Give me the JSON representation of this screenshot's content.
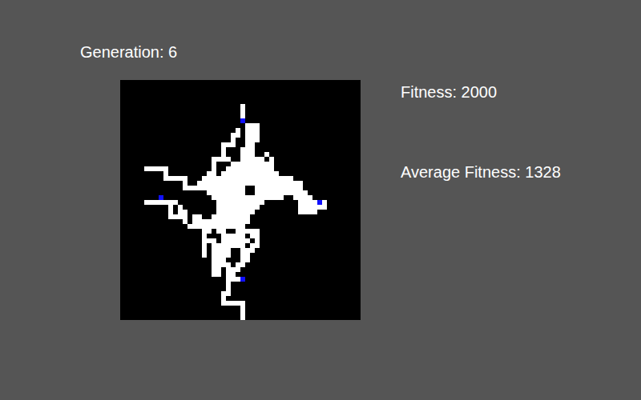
{
  "generation": {
    "label": "Generation: 6"
  },
  "stats": [
    {
      "label": "Fitness: 2000"
    },
    {
      "label": "Average Fitness: 1328"
    }
  ],
  "board": {
    "legend": {
      "empty": ".",
      "filled": "#",
      "agent": "o"
    },
    "rows": [
      "..................................................",
      "..................................................",
      "..................................................",
      "..................................................",
      "..................................................",
      ".........................#........................",
      ".........................#........................",
      ".........................#........................",
      ".........................o........................",
      "..........................###.....................",
      "........................#.###.....................",
      ".......................##.###.....................",
      ".......................#..###.....................",
      ".....................###..##......................",
      ".....................#...###......................",
      ".....................#...###..#...................",
      "...................####..#####.#..................",
      "...................#...#########..................",
      ".....#####.........#..##########..................",
      ".........#........##.############.................",
      ".........#####...###################..............",
      ".............#..######################............",
      ".............#############..##########............",
      "..................########..###########...........",
      "........o..........###############..####..........",
      ".....#######........##########.......####o#.......",
      "..........#.#.......#########........######.......",
      "..........#.##......########.........####.........",
      "..........####.##..########.......................",
      ".............#.############.......................",
      "..............############........................",
      ".................##.##..#####.....................",
      ".................#...#####.##.....................",
      ".................###.######.#.....................",
      ".................#.#######.##.....................",
      ".................#.####..###......................",
      ".................#.####..##.......................",
      "...................###...##.......................",
      "...................####.##........................",
      "...................##.###.........................",
      "...................##.##..........................",
      "......................###o........................",
      "......................#...........................",
      "......................#...........................",
      ".....................##...........................",
      ".....................#............................",
      ".....................#####........................",
      ".........................#........................",
      ".........................#........................",
      ".........................#........................"
    ]
  }
}
